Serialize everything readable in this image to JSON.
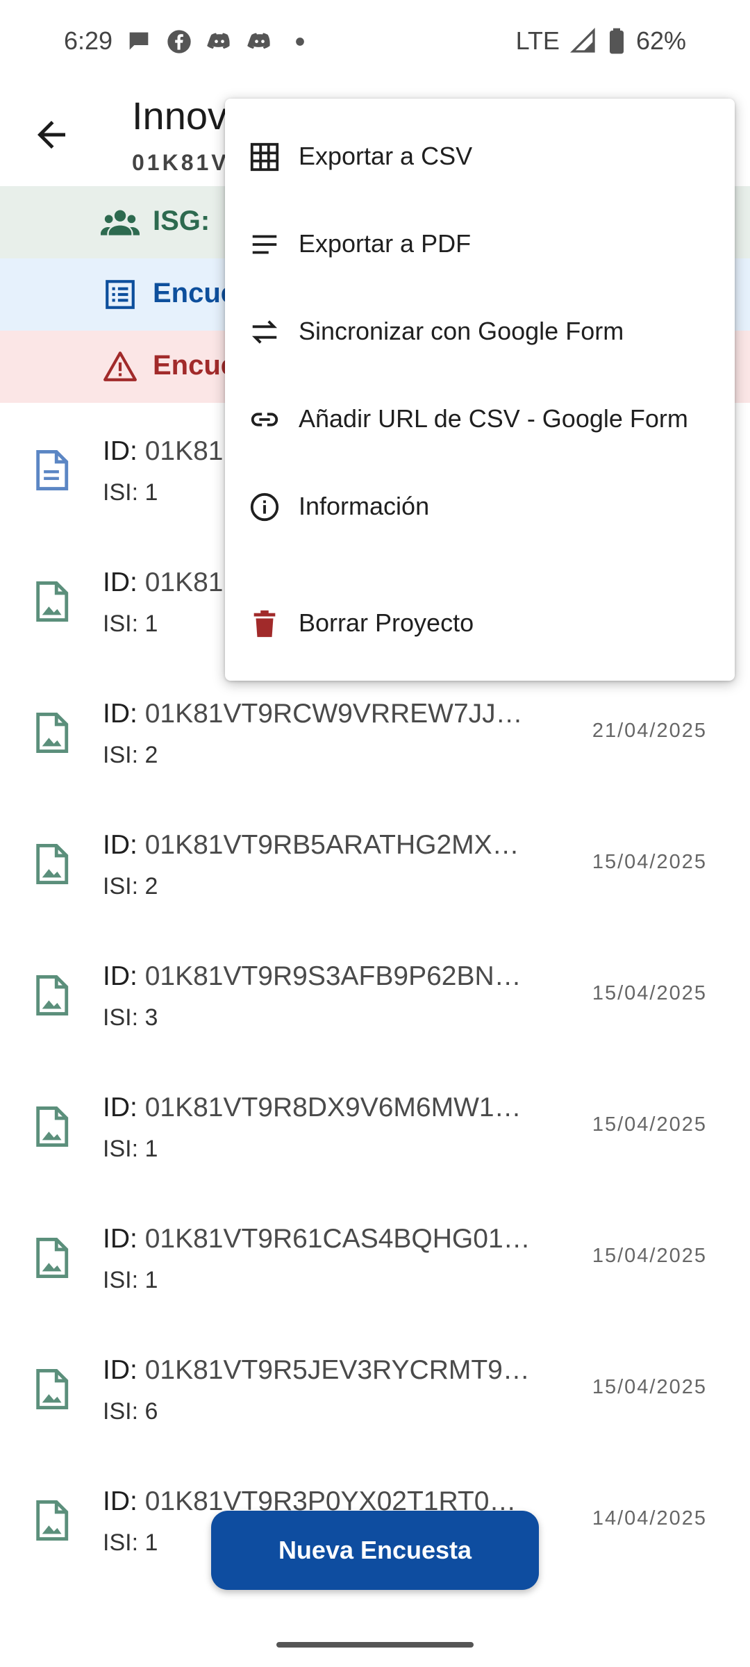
{
  "status_bar": {
    "time": "6:29",
    "network": "LTE",
    "battery": "62%"
  },
  "app_bar": {
    "title": "Innov",
    "subtitle": "01K81V"
  },
  "banners": {
    "isg_label": "ISG:",
    "surveys_label": "Encue",
    "warning_label": "Encue"
  },
  "menu": {
    "items": [
      {
        "label": "Exportar a CSV",
        "icon": "table-icon"
      },
      {
        "label": "Exportar a PDF",
        "icon": "text-lines-icon"
      },
      {
        "label": "Sincronizar con Google Form",
        "icon": "sync-arrows-icon"
      },
      {
        "label": "Añadir URL de CSV - Google Form",
        "icon": "link-icon"
      },
      {
        "label": "Información",
        "icon": "info-icon"
      },
      {
        "label": "Borrar Proyecto",
        "icon": "trash-icon"
      }
    ]
  },
  "list": {
    "id_prefix": "ID:",
    "items": [
      {
        "id": "01K81",
        "isi": "ISI: 1",
        "date": "",
        "icon": "document-icon"
      },
      {
        "id": "01K81",
        "isi": "ISI: 1",
        "date": "",
        "icon": "image-file-icon"
      },
      {
        "id": "01K81VT9RCW9VRREW7JJ…",
        "isi": "ISI: 2",
        "date": "21/04/2025",
        "icon": "image-file-icon"
      },
      {
        "id": "01K81VT9RB5ARATHG2MX…",
        "isi": "ISI: 2",
        "date": "15/04/2025",
        "icon": "image-file-icon"
      },
      {
        "id": "01K81VT9R9S3AFB9P62BN…",
        "isi": "ISI: 3",
        "date": "15/04/2025",
        "icon": "image-file-icon"
      },
      {
        "id": "01K81VT9R8DX9V6M6MW1…",
        "isi": "ISI: 1",
        "date": "15/04/2025",
        "icon": "image-file-icon"
      },
      {
        "id": "01K81VT9R61CAS4BQHG01…",
        "isi": "ISI: 1",
        "date": "15/04/2025",
        "icon": "image-file-icon"
      },
      {
        "id": "01K81VT9R5JEV3RYCRMT9…",
        "isi": "ISI: 6",
        "date": "15/04/2025",
        "icon": "image-file-icon"
      },
      {
        "id": "01K81VT9R3P0YX02T1RT0…",
        "isi": "ISI: 1",
        "date": "14/04/2025",
        "icon": "image-file-icon"
      }
    ]
  },
  "fab": {
    "label": "Nueva Encuesta"
  },
  "colors": {
    "primary": "#0e4da0",
    "isg_banner_bg": "#e8efea",
    "isg_text": "#2d6a4f",
    "surveys_banner_bg": "#e6f1fc",
    "warning_banner_bg": "#fbe6e6",
    "warning_text": "#a12a2a",
    "trash_icon": "#a12a2a",
    "file_icon": "#5b8f7b"
  }
}
